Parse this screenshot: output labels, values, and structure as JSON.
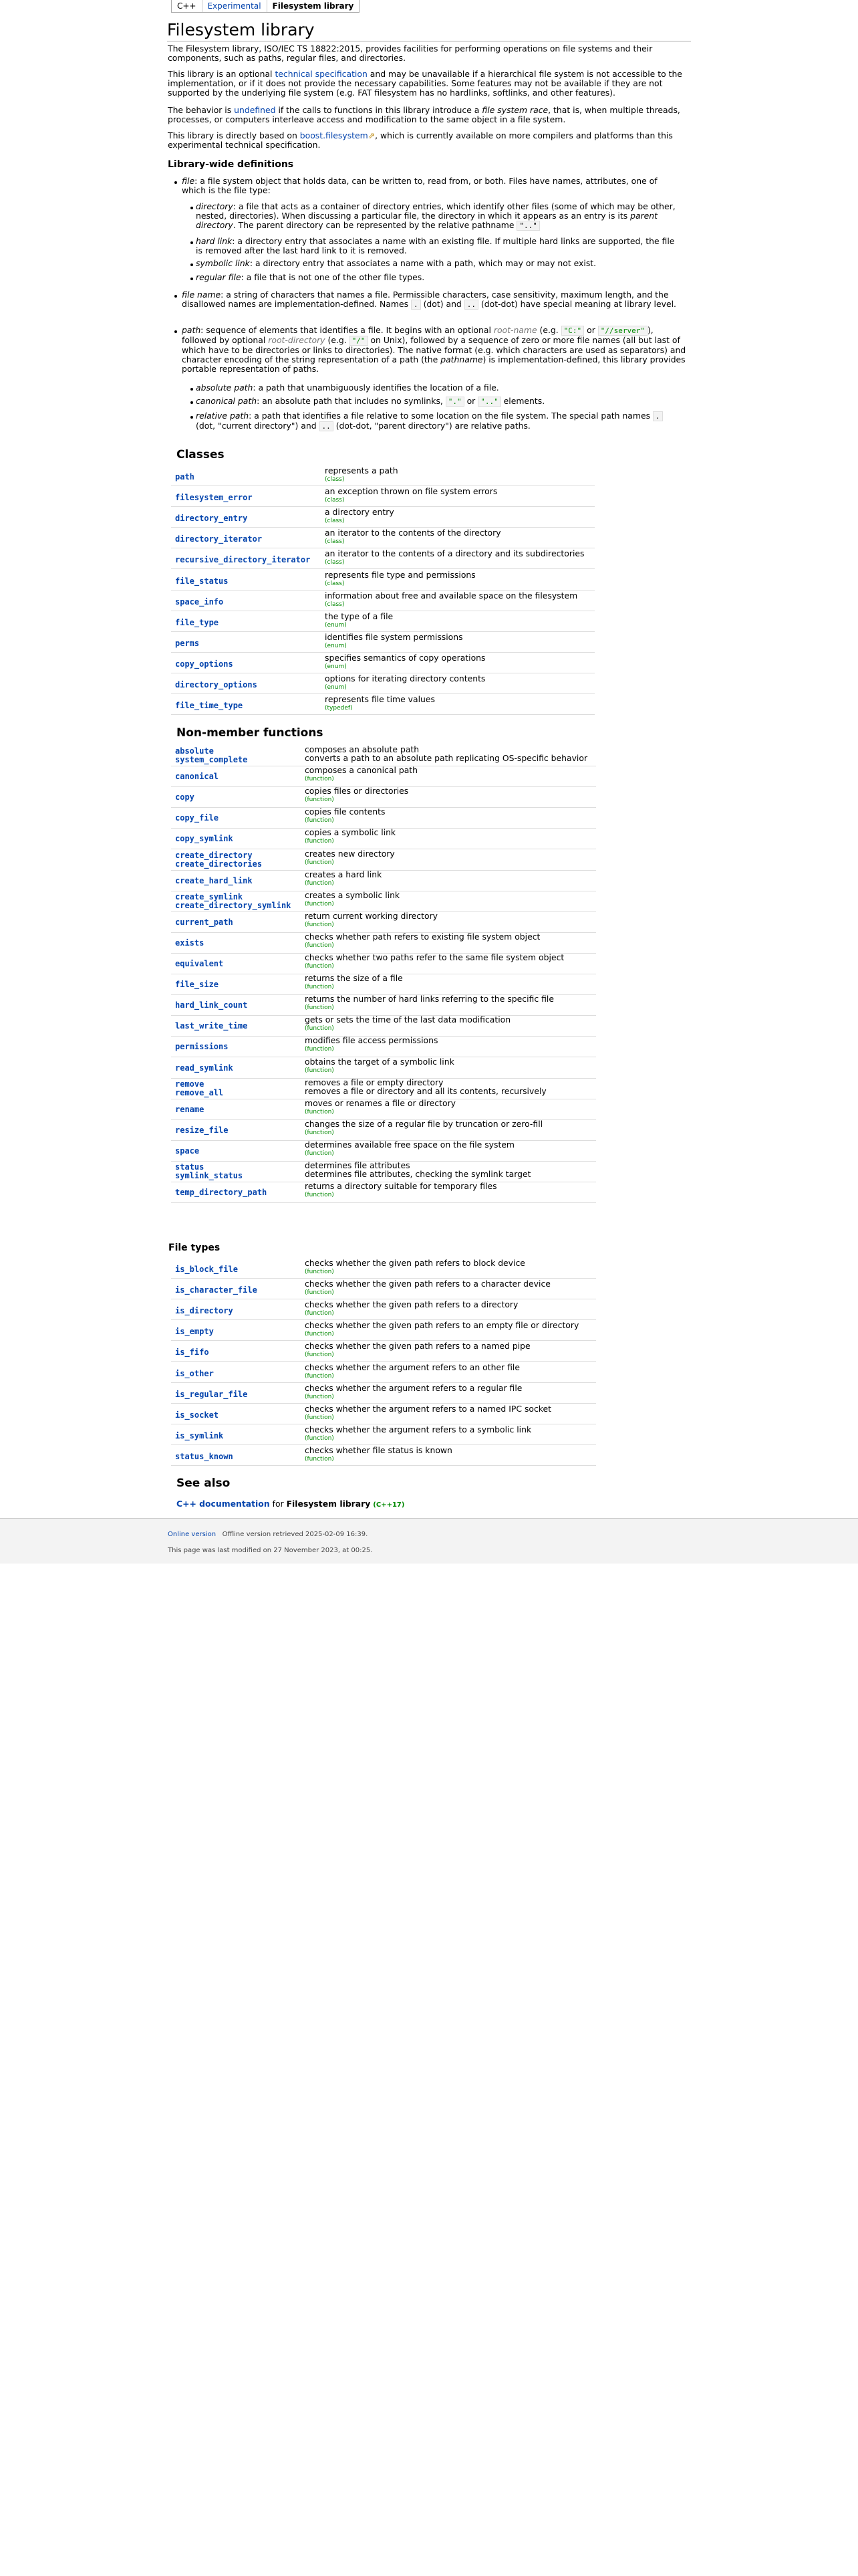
{
  "breadcrumb": [
    "C++",
    "Experimental",
    "Filesystem library"
  ],
  "title": "Filesystem library",
  "intro": {
    "p1": "The Filesystem library, ISO/IEC TS 18822:2015, provides facilities for performing operations on file systems and their components, such as paths, regular files, and directories.",
    "p2a": "This library is an optional ",
    "p2link": "technical specification",
    "p2b": " and may be unavailable if a hierarchical file system is not accessible to the implementation, or if it does not provide the necessary capabilities. Some features may not be available if they are not supported by the underlying file system (e.g. FAT filesystem has no hardlinks, softlinks, and other features).",
    "p3a": "The behavior is ",
    "p3link": "undefined",
    "p3b": " if the calls to functions in this library introduce a ",
    "p3c": "file system race",
    "p3d": ", that is, when multiple threads, processes, or computers interleave access and modification to the same object in a file system.",
    "p4a": "This library is directly based on ",
    "p4link": "boost.filesystem",
    "p4b": ", which is currently available on more compilers and platforms than this experimental technical specification."
  },
  "defs_heading": "Library-wide definitions",
  "defs": {
    "file": {
      "term": "file",
      "text": ": a file system object that holds data, can be written to, read from, or both. Files have names, attributes, one of which is the file type:"
    },
    "directory": {
      "term": "directory",
      "text": ": a file that acts as a container of directory entries, which identify other files (some of which may be other, nested, directories). When discussing a particular file, the directory in which it appears as an entry is its ",
      "term2": "parent directory",
      "text2": ". The parent directory can be represented by the relative pathname ",
      "code": "\"..\""
    },
    "hardlink": {
      "term": "hard link",
      "text": ": a directory entry that associates a name with an existing file. If multiple hard links are supported, the file is removed after the last hard link to it is removed."
    },
    "symlink": {
      "term": "symbolic link",
      "text": ": a directory entry that associates a name with a path, which may or may not exist."
    },
    "regular": {
      "term": "regular file",
      "text": ": a file that is not one of the other file types."
    },
    "filename": {
      "term": "file name",
      "text": ": a string of characters that names a file. Permissible characters, case sensitivity, maximum length, and the disallowed names are implementation-defined. Names ",
      "c1": ".",
      "mid": " (dot) and ",
      "c2": "..",
      "end": " (dot-dot) have special meaning at library level."
    },
    "path": {
      "term": "path",
      "text": ": sequence of elements that identifies a file. It begins with an optional ",
      "rn": "root-name",
      "t2": " (e.g. ",
      "c1": "\"C:\"",
      "or": " or ",
      "c2": "\"//server\"",
      "t3": "), followed by optional ",
      "rd": "root-directory",
      "t4": " (e.g. ",
      "c3": "\"/\"",
      "t5": " on Unix), followed by a sequence of zero or more file names (all but last of which have to be directories or links to directories). The native format (e.g. which characters are used as separators) and character encoding of the string representation of a path (the ",
      "pn": "pathname",
      "t6": ") is implementation-defined, this library provides portable representation of paths."
    },
    "abspath": {
      "term": "absolute path",
      "text": ": a path that unambiguously identifies the location of a file."
    },
    "canpath": {
      "term": "canonical path",
      "text": ": an absolute path that includes no symlinks, ",
      "c1": "\".\"",
      "or": " or ",
      "c2": "\"..\"",
      "end": " elements."
    },
    "relpath": {
      "term": "relative path",
      "text": ": a path that identifies a file relative to some location on the file system. The special path names ",
      "c1": ".",
      "mid": " (dot, \"current directory\") and ",
      "c2": "..",
      "end": " (dot-dot, \"parent directory\") are relative paths."
    }
  },
  "classes_heading": "Classes",
  "classes": [
    {
      "name": "path",
      "desc": "represents a path",
      "kind": "(class)"
    },
    {
      "name": "filesystem_error",
      "desc": "an exception thrown on file system errors",
      "kind": "(class)"
    },
    {
      "name": "directory_entry",
      "desc": "a directory entry",
      "kind": "(class)"
    },
    {
      "name": "directory_iterator",
      "desc": "an iterator to the contents of the directory",
      "kind": "(class)"
    },
    {
      "name": "recursive_directory_iterator",
      "desc": "an iterator to the contents of a directory and its subdirectories",
      "kind": "(class)"
    },
    {
      "name": "file_status",
      "desc": "represents file type and permissions",
      "kind": "(class)"
    },
    {
      "name": "space_info",
      "desc": "information about free and available space on the filesystem",
      "kind": "(class)"
    },
    {
      "name": "file_type",
      "desc": "the type of a file",
      "kind": "(enum)"
    },
    {
      "name": "perms",
      "desc": "identifies file system permissions",
      "kind": "(enum)"
    },
    {
      "name": "copy_options",
      "desc": "specifies semantics of copy operations",
      "kind": "(enum)"
    },
    {
      "name": "directory_options",
      "desc": "options for iterating directory contents",
      "kind": "(enum)"
    },
    {
      "name": "file_time_type",
      "desc": "represents file time values",
      "kind": "(typedef)"
    }
  ],
  "functions_heading": "Non-member functions",
  "functions": [
    {
      "n1": "absolute",
      "n2": "system_complete",
      "d1": "composes an absolute path",
      "d2": "converts a path to an absolute path replicating OS-specific behavior",
      "kind": "(function)"
    },
    {
      "n1": "canonical",
      "n2": "",
      "d1": "composes a canonical path",
      "d2": "",
      "kind": "(function)"
    },
    {
      "n1": "copy",
      "n2": "",
      "d1": "copies files or directories",
      "d2": "",
      "kind": "(function)"
    },
    {
      "n1": "copy_file",
      "n2": "",
      "d1": "copies file contents",
      "d2": "",
      "kind": "(function)"
    },
    {
      "n1": "copy_symlink",
      "n2": "",
      "d1": "copies a symbolic link",
      "d2": "",
      "kind": "(function)"
    },
    {
      "n1": "create_directory",
      "n2": "create_directories",
      "d1": "creates new directory",
      "d2": "",
      "kind": "(function)"
    },
    {
      "n1": "create_hard_link",
      "n2": "",
      "d1": "creates a hard link",
      "d2": "",
      "kind": "(function)"
    },
    {
      "n1": "create_symlink",
      "n2": "create_directory_symlink",
      "d1": "creates a symbolic link",
      "d2": "",
      "kind": "(function)"
    },
    {
      "n1": "current_path",
      "n2": "",
      "d1": "return current working directory",
      "d2": "",
      "kind": "(function)"
    },
    {
      "n1": "exists",
      "n2": "",
      "d1": "checks whether path refers to existing file system object",
      "d2": "",
      "kind": "(function)"
    },
    {
      "n1": "equivalent",
      "n2": "",
      "d1": "checks whether two paths refer to the same file system object",
      "d2": "",
      "kind": "(function)"
    },
    {
      "n1": "file_size",
      "n2": "",
      "d1": "returns the size of a file",
      "d2": "",
      "kind": "(function)"
    },
    {
      "n1": "hard_link_count",
      "n2": "",
      "d1": "returns the number of hard links referring to the specific file",
      "d2": "",
      "kind": "(function)"
    },
    {
      "n1": "last_write_time",
      "n2": "",
      "d1": "gets or sets the time of the last data modification",
      "d2": "",
      "kind": "(function)"
    },
    {
      "n1": "permissions",
      "n2": "",
      "d1": "modifies file access permissions",
      "d2": "",
      "kind": "(function)"
    },
    {
      "n1": "read_symlink",
      "n2": "",
      "d1": "obtains the target of a symbolic link",
      "d2": "",
      "kind": "(function)"
    },
    {
      "n1": "remove",
      "n2": "remove_all",
      "d1": "removes a file or empty directory",
      "d2": "removes a file or directory and all its contents, recursively",
      "kind": "(function)"
    },
    {
      "n1": "rename",
      "n2": "",
      "d1": "moves or renames a file or directory",
      "d2": "",
      "kind": "(function)"
    },
    {
      "n1": "resize_file",
      "n2": "",
      "d1": "changes the size of a regular file by truncation or zero-fill",
      "d2": "",
      "kind": "(function)"
    },
    {
      "n1": "space",
      "n2": "",
      "d1": "determines available free space on the file system",
      "d2": "",
      "kind": "(function)"
    },
    {
      "n1": "status",
      "n2": "symlink_status",
      "d1": "determines file attributes",
      "d2": "determines file attributes, checking the symlink target",
      "kind": "(function)"
    },
    {
      "n1": "temp_directory_path",
      "n2": "",
      "d1": "returns a directory suitable for temporary files",
      "d2": "",
      "kind": "(function)"
    }
  ],
  "filetypes_heading": "File types",
  "filetypes": [
    {
      "name": "is_block_file",
      "desc": "checks whether the given path refers to block device",
      "kind": "(function)"
    },
    {
      "name": "is_character_file",
      "desc": "checks whether the given path refers to a character device",
      "kind": "(function)"
    },
    {
      "name": "is_directory",
      "desc": "checks whether the given path refers to a directory",
      "kind": "(function)"
    },
    {
      "name": "is_empty",
      "desc": "checks whether the given path refers to an empty file or directory",
      "kind": "(function)"
    },
    {
      "name": "is_fifo",
      "desc": "checks whether the given path refers to a named pipe",
      "kind": "(function)"
    },
    {
      "name": "is_other",
      "desc": "checks whether the argument refers to an other file",
      "kind": "(function)"
    },
    {
      "name": "is_regular_file",
      "desc": "checks whether the argument refers to a regular file",
      "kind": "(function)"
    },
    {
      "name": "is_socket",
      "desc": "checks whether the argument refers to a named IPC socket",
      "kind": "(function)"
    },
    {
      "name": "is_symlink",
      "desc": "checks whether the argument refers to a symbolic link",
      "kind": "(function)"
    },
    {
      "name": "status_known",
      "desc": "checks whether file status is known",
      "kind": "(function)"
    }
  ],
  "seealso_heading": "See also",
  "seealso": {
    "link": "C++ documentation",
    "for": " for ",
    "bold": "Filesystem library",
    "tag": "(C++17)"
  },
  "footer": {
    "online": "Online version",
    "offline": "Offline version retrieved 2025-02-09 16:39.",
    "modified": "This page was last modified on 27 November 2023, at 00:25."
  },
  "colors": {
    "link": "#0645ad",
    "kind": "#008000",
    "footer_bg": "#f3f3f3"
  }
}
